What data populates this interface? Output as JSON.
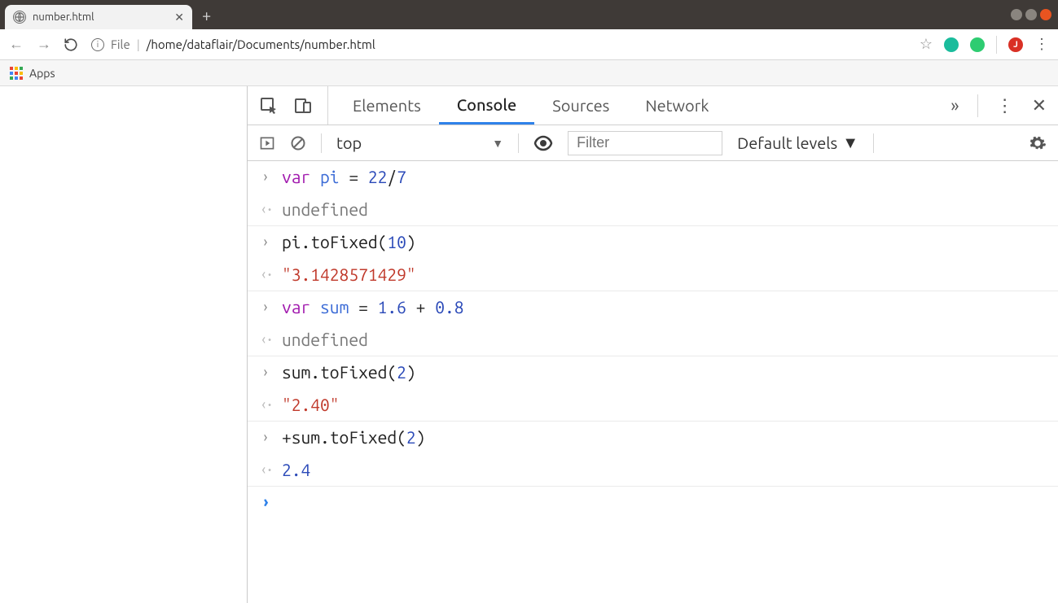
{
  "tab": {
    "title": "number.html"
  },
  "url": {
    "scheme": "File",
    "path": "/home/dataflair/Documents/number.html"
  },
  "bookmarks": {
    "apps_label": "Apps"
  },
  "avatar_letter": "J",
  "devtools": {
    "tabs": {
      "elements": "Elements",
      "console": "Console",
      "sources": "Sources",
      "network": "Network"
    },
    "toolbar": {
      "context": "top",
      "filter_placeholder": "Filter",
      "levels": "Default levels"
    }
  },
  "console": {
    "lines": [
      {
        "t": "in",
        "tokens": [
          [
            "kw",
            "var"
          ],
          [
            "sp",
            " "
          ],
          [
            "var",
            "pi"
          ],
          [
            "sp",
            " "
          ],
          [
            "op",
            "="
          ],
          [
            "sp",
            " "
          ],
          [
            "num",
            "22"
          ],
          [
            "op",
            "/"
          ],
          [
            "num",
            "7"
          ]
        ]
      },
      {
        "t": "out",
        "tokens": [
          [
            "undef",
            "undefined"
          ]
        ]
      },
      {
        "t": "in",
        "tokens": [
          [
            "txt",
            "pi.toFixed("
          ],
          [
            "num",
            "10"
          ],
          [
            "txt",
            ")"
          ]
        ]
      },
      {
        "t": "out",
        "tokens": [
          [
            "str",
            "\"3.1428571429\""
          ]
        ]
      },
      {
        "t": "in",
        "tokens": [
          [
            "kw",
            "var"
          ],
          [
            "sp",
            " "
          ],
          [
            "var",
            "sum"
          ],
          [
            "sp",
            " "
          ],
          [
            "op",
            "="
          ],
          [
            "sp",
            " "
          ],
          [
            "num",
            "1.6"
          ],
          [
            "sp",
            " "
          ],
          [
            "op",
            "+"
          ],
          [
            "sp",
            " "
          ],
          [
            "num",
            "0.8"
          ]
        ]
      },
      {
        "t": "out",
        "tokens": [
          [
            "undef",
            "undefined"
          ]
        ]
      },
      {
        "t": "in",
        "tokens": [
          [
            "txt",
            "sum.toFixed("
          ],
          [
            "num",
            "2"
          ],
          [
            "txt",
            ")"
          ]
        ]
      },
      {
        "t": "out",
        "tokens": [
          [
            "str",
            "\"2.40\""
          ]
        ]
      },
      {
        "t": "in",
        "tokens": [
          [
            "txt",
            "+sum.toFixed("
          ],
          [
            "num",
            "2"
          ],
          [
            "txt",
            ")"
          ]
        ]
      },
      {
        "t": "out",
        "tokens": [
          [
            "numres",
            "2.4"
          ]
        ]
      }
    ]
  }
}
